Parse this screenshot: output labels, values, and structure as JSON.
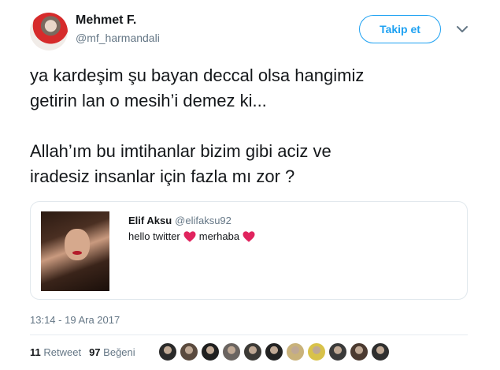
{
  "author": {
    "name": "Mehmet F.",
    "handle": "@mf_harmandali"
  },
  "follow_label": "Takip et",
  "tweet": {
    "paragraphs": [
      "ya kardeşim şu bayan deccal olsa hangimiz\ngetirin lan o mesih’i demez ki...",
      "Allah’ım bu imtihanlar bizim gibi aciz ve\niradesiz insanlar için fazla mı zor ?"
    ]
  },
  "quote": {
    "name": "Elif Aksu",
    "handle": "@elifaksu92",
    "text_part1": "hello twitter",
    "text_part2": "merhaba"
  },
  "timestamp": "13:14 - 19 Ara 2017",
  "stats": {
    "retweets_count": "11",
    "retweets_label": "Retweet",
    "likes_count": "97",
    "likes_label": "Beğeni"
  },
  "likers_colors": [
    "#2a2a2a",
    "#5a4a3e",
    "#1f1f1f",
    "#6a6460",
    "#3c3a36",
    "#222222",
    "#c9b27a",
    "#d8c24a",
    "#3a3a3a",
    "#4b3a30",
    "#2f2f2f"
  ],
  "colors": {
    "accent": "#1da1f2",
    "heart": "#e0245e",
    "muted": "#657786"
  }
}
